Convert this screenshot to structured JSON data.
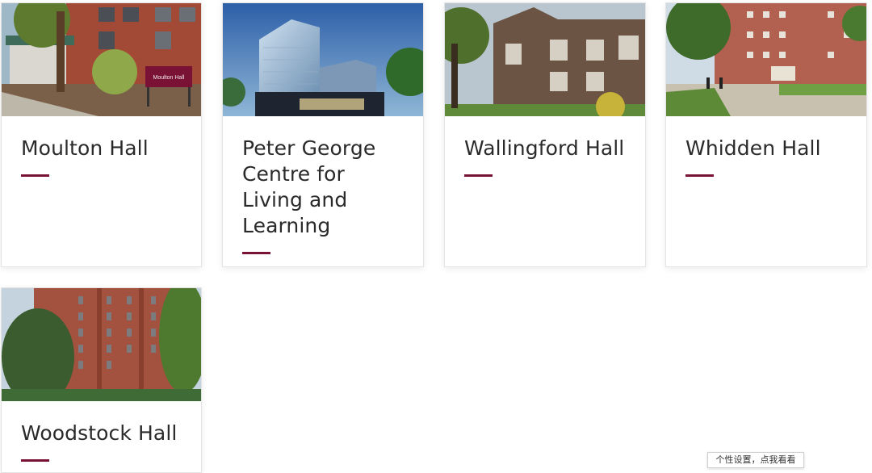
{
  "theme": {
    "accent": "#7a1236",
    "text": "#2a2a2a"
  },
  "cards": [
    {
      "title": "Moulton Hall",
      "photo": "building-photo",
      "sign_text": "Moulton Hall"
    },
    {
      "title": "Peter George Centre for Living and Learning",
      "photo": "building-photo"
    },
    {
      "title": "Wallingford Hall",
      "photo": "building-photo"
    },
    {
      "title": "Whidden Hall",
      "photo": "building-photo"
    },
    {
      "title": "Woodstock Hall",
      "photo": "building-photo"
    }
  ],
  "tooltip": {
    "text": "个性设置，点我看看"
  }
}
